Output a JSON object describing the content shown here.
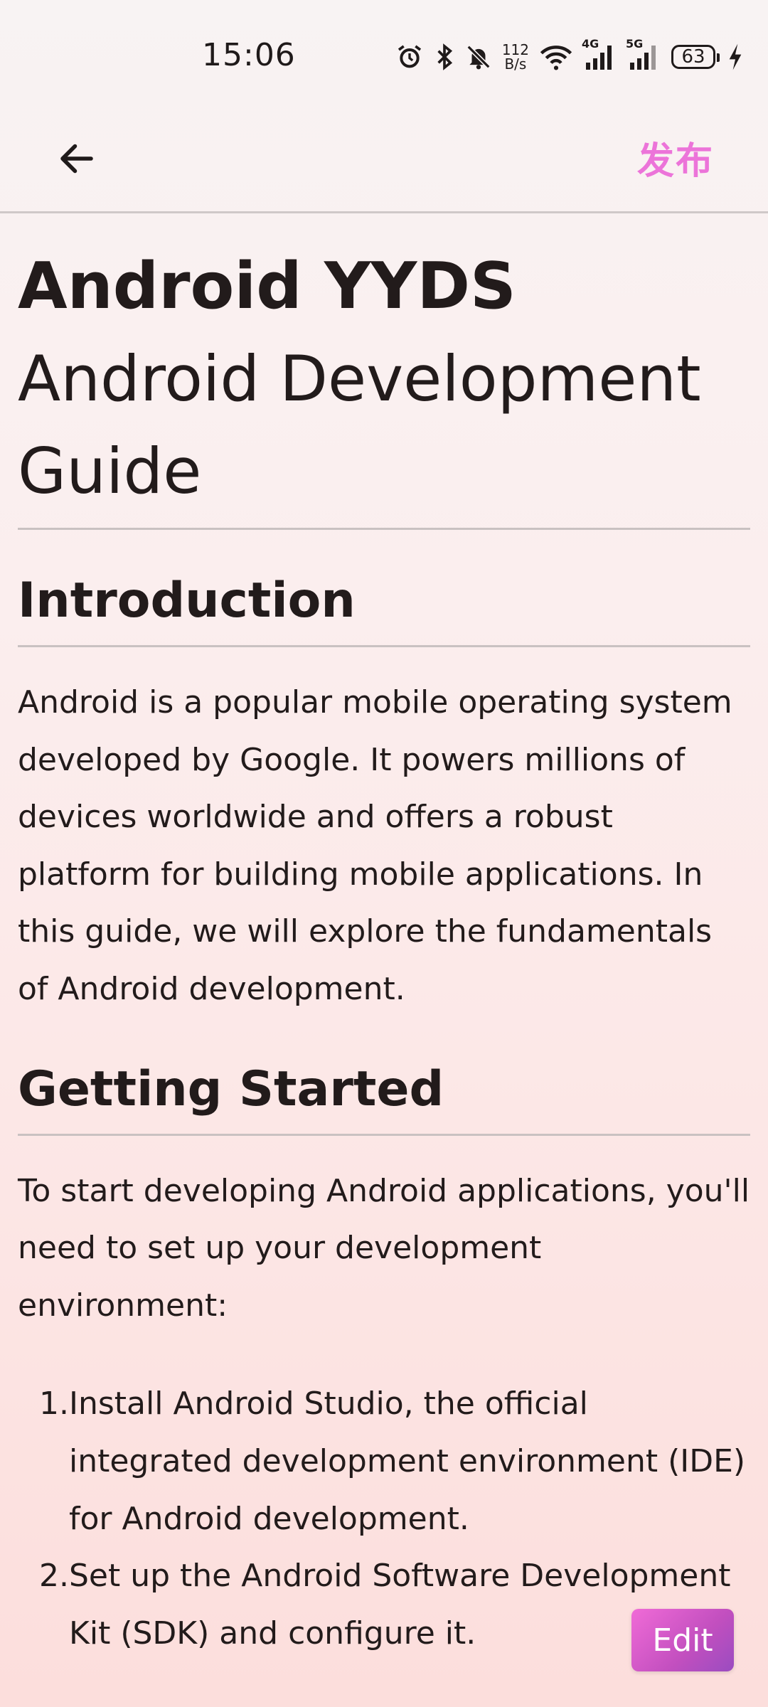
{
  "status_bar": {
    "time": "15:06",
    "net_speed_value": "112",
    "net_speed_unit": "B/s",
    "signal_4g": "4G",
    "signal_5g": "5G",
    "battery": "63",
    "icons": [
      "alarm-icon",
      "bluetooth-icon",
      "mute-icon",
      "wifi-icon",
      "signal-4g-icon",
      "signal-5g-icon",
      "battery-icon",
      "charging-icon"
    ]
  },
  "app_bar": {
    "back_icon": "arrow-left-icon",
    "publish_label": "发布",
    "publish_color": "#ec74d9"
  },
  "article": {
    "title_line1": "Android YYDS",
    "title_line2": "Android Development",
    "title_line3": "Guide",
    "section1_heading": "Introduction",
    "section1_text": "Android is a popular mobile operating system developed by Google. It powers millions of devices worldwide and offers a robust platform for building mobile applications. In this guide, we will explore the fundamentals of Android development.",
    "section2_heading": "Getting Started",
    "section2_text": "To start developing Android applications, you'll need to set up your development environment:",
    "steps": [
      {
        "num": "1.",
        "text": "Install Android Studio, the official integrated development environment (IDE) for Android development."
      },
      {
        "num": "2.",
        "text": "Set up the Android Software Development Kit (SDK) and configure it."
      }
    ]
  },
  "fab": {
    "edit_label": "Edit",
    "gradient_start": "#f06bd7",
    "gradient_end": "#9a4cc0"
  }
}
